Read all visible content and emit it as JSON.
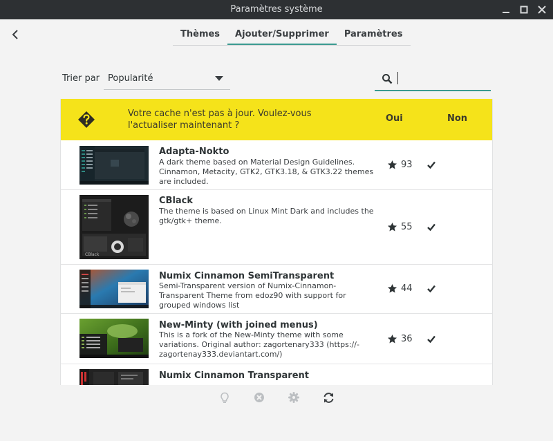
{
  "window": {
    "title": "Paramètres système"
  },
  "tabs": [
    {
      "label": "Thèmes",
      "active": false
    },
    {
      "label": "Ajouter/Supprimer",
      "active": true
    },
    {
      "label": "Paramètres",
      "active": false
    }
  ],
  "sort": {
    "label": "Trier par",
    "value": "Popularité"
  },
  "search": {
    "value": "",
    "placeholder": ""
  },
  "banner": {
    "message": "Votre cache n'est pas à jour. Voulez-vous l'actualiser maintenant ?",
    "yes_label": "Oui",
    "no_label": "Non",
    "background": "#f5e31a"
  },
  "themes": [
    {
      "name": "Adapta-Nokto",
      "description": "A dark theme based on Material Design Guidelines. Cinnamon, Metacity, GTK2, GTK3.18, & GTK3.22 themes are included.",
      "score": "93",
      "installed": true
    },
    {
      "name": "CBlack",
      "description": "The theme is based on Linux Mint Dark and includes the gtk/gtk+ theme.",
      "score": "55",
      "installed": true
    },
    {
      "name": "Numix Cinnamon SemiTransparent",
      "description": "Semi-Transparent version of Numix-Cinnamon-Transparent Theme from edoz90 with support for grouped windows list",
      "score": "44",
      "installed": true
    },
    {
      "name": "New-Minty (with joined menus)",
      "description": "This is a fork of the New-Minty theme with some variations. Original author: zagortenary333 (https://-zagortenay333.deviantart.com/)",
      "score": "36",
      "installed": true
    },
    {
      "name": "Numix Cinnamon Transparent",
      "description": "",
      "score": "",
      "installed": false
    }
  ],
  "icons": {
    "back": "back-arrow-icon",
    "search": "search-icon",
    "banner": "question-diamond-icon",
    "star": "star-icon",
    "check": "check-icon",
    "toolbar": [
      "lightbulb-icon",
      "remove-icon",
      "gear-icon",
      "refresh-icon"
    ]
  },
  "colors": {
    "accent": "#3a9a90",
    "titlebar": "#2d3033"
  }
}
